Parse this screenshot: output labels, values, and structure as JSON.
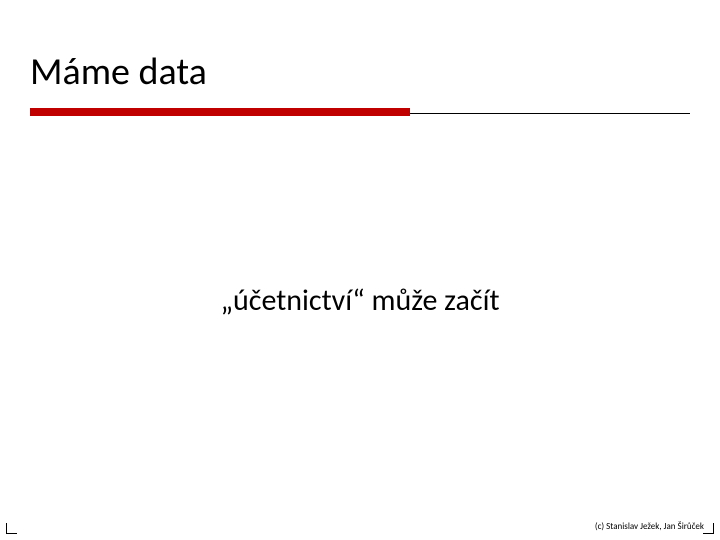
{
  "slide": {
    "title": "Máme data",
    "subtitle": "„účetnictví“ může začít",
    "footer": "(c) Stanislav Ježek, Jan Širůček"
  },
  "colors": {
    "accent": "#c00000"
  }
}
